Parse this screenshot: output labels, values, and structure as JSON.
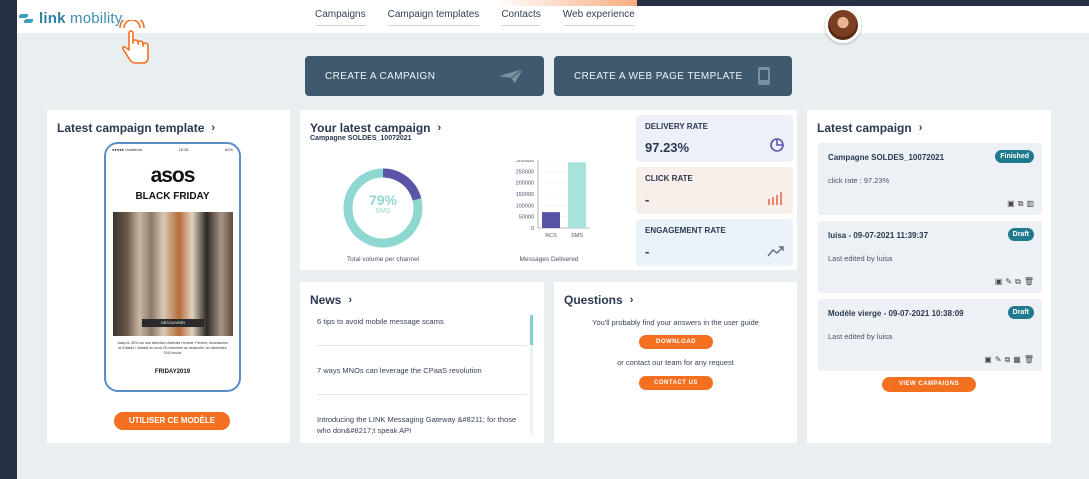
{
  "header": {
    "logo_bold": "link",
    "logo_rest": " mobility",
    "nav": [
      "Campaigns",
      "Campaign templates",
      "Contacts",
      "Web experience"
    ]
  },
  "cta": {
    "create_campaign": "CREATE A CAMPAIGN",
    "create_web_template": "CREATE A WEB PAGE TEMPLATE"
  },
  "template_card": {
    "title": "Latest campaign template",
    "phone_status_left": "●●●●● Vodafone",
    "phone_status_center": "15:26",
    "phone_status_right": "82%",
    "brand": "asos",
    "headline": "BLACK FRIDAY",
    "photo_button": "DÉCOUVRIR",
    "fine_print": "Jusqu'à -30% sur une sélection d'articles Homme, Femme, Accessoires et Enfants ! Valable du lundi 25 novembre au dimanche 1er décembre 2019 inclus",
    "promo_code": "FRIDAY2019",
    "use_button": "UTILISER CE MODÈLE"
  },
  "your_campaign": {
    "title": "Your latest campaign",
    "subtitle": "Campagne SOLDES_10072021",
    "donut_percent": "79%",
    "donut_channel": "SMS",
    "donut_caption": "Total volume per channel",
    "bar_caption": "Messages Delivered"
  },
  "chart_data": {
    "type": "bar",
    "categories": [
      "RCS",
      "SMS"
    ],
    "values": [
      70000,
      290000
    ],
    "xlabel": "Messages Delivered",
    "ylabel": "",
    "ylim": [
      0,
      300000
    ],
    "yticks": [
      "300000",
      "250000",
      "200000",
      "150000",
      "100000",
      "50000",
      "0"
    ],
    "colors": [
      "#5754a8",
      "#a6e3db"
    ]
  },
  "donut_data": {
    "value": 79,
    "colors": {
      "main": "#8fd8d2",
      "rest": "#5a55a8"
    }
  },
  "metrics": [
    {
      "label": "DELIVERY RATE",
      "value": "97.23%"
    },
    {
      "label": "CLICK RATE",
      "value": "-"
    },
    {
      "label": "ENGAGEMENT RATE",
      "value": "-"
    }
  ],
  "latest_campaign": {
    "title": "Latest campaign",
    "items": [
      {
        "title": "Campagne SOLDES_10072021",
        "sub": "click rate : 97.23%",
        "badge": "Finished"
      },
      {
        "title": "luisa - 09-07-2021 11:39:37",
        "sub": "Last edited by luisa",
        "badge": "Draft"
      },
      {
        "title": "Modèle vierge - 09-07-2021 10:38:09",
        "sub": "Last edited by luisa",
        "badge": "Draft"
      }
    ],
    "view_button": "VIEW CAMPAIGNS"
  },
  "news": {
    "title": "News",
    "items": [
      "6 tips to avoid mobile message scams",
      "7 ways MNOs can leverage the CPaaS revolution",
      "Introducing the LINK Messaging Gateway &#8211; for those who don&#8217;t speak API"
    ]
  },
  "questions": {
    "title": "Questions",
    "line1": "You'll probably find your answers in the user guide",
    "download": "DOWNLOAD",
    "line2": "or contact our team for any request",
    "contact": "CONTACT US"
  },
  "colors": {
    "accent": "#f37021",
    "primary_button": "#3f5a6e",
    "badge": "#1e7a8c"
  }
}
